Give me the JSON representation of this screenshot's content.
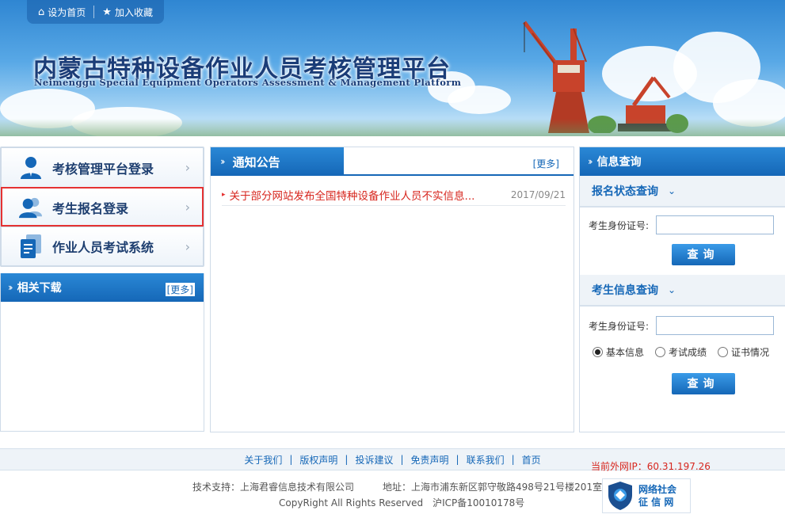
{
  "topbar": {
    "set_home": "设为首页",
    "add_favorite": "加入收藏"
  },
  "header": {
    "title": "内蒙古特种设备作业人员考核管理平台",
    "subtitle": "Neimenggu Special Equipment Operators Assessment & Management Platform"
  },
  "left_nav": {
    "items": [
      {
        "label": "考核管理平台登录",
        "icon": "user-icon"
      },
      {
        "label": "考生报名登录",
        "icon": "users-icon",
        "highlighted": true
      },
      {
        "label": "作业人员考试系统",
        "icon": "documents-icon"
      }
    ]
  },
  "downloads": {
    "title": "相关下载",
    "more": "[更多]"
  },
  "notices": {
    "title": "通知公告",
    "more": "[更多]",
    "items": [
      {
        "text": "关于部分网站发布全国特种设备作业人员不实信息...",
        "date": "2017/09/21"
      }
    ]
  },
  "info_query": {
    "title": "信息查询",
    "status_section": {
      "title": "报名状态查询",
      "id_label": "考生身份证号:",
      "id_value": "",
      "button": "查询"
    },
    "info_section": {
      "title": "考生信息查询",
      "id_label": "考生身份证号:",
      "id_value": "",
      "options": [
        "基本信息",
        "考试成绩",
        "证书情况"
      ],
      "selected_option": "基本信息",
      "button": "查询"
    }
  },
  "footer": {
    "links": [
      "关于我们",
      "版权声明",
      "投诉建议",
      "免责声明",
      "联系我们",
      "首页"
    ],
    "ip_text": "当前外网IP：60.31.197.26",
    "support_line": "技术支持：上海君睿信息技术有限公司　　　地址：上海市浦东新区郭守敬路498号21号楼201室",
    "copyright_line": "CopyRight All Rights Reserved　沪ICP备10010178号",
    "badge_line1": "网络社会",
    "badge_line2": "征 信 网"
  },
  "colors": {
    "brand_blue": "#1567b7",
    "title_navy": "#1b3d78",
    "notice_red": "#d7261e",
    "highlight_border": "#e53232"
  }
}
